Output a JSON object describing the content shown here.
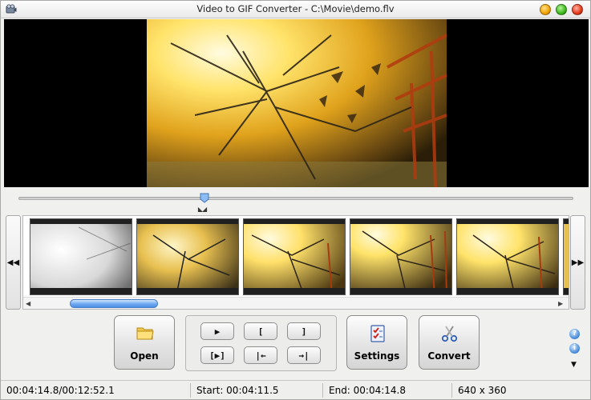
{
  "window": {
    "title": "Video to GIF Converter - C:\\Movie\\demo.flv"
  },
  "icons": {
    "app": "film-reel-icon",
    "open": "folder-icon",
    "settings": "checklist-icon",
    "convert": "scissors-icon",
    "help": "help-icon",
    "info": "info-icon"
  },
  "colors": {
    "accent_blue": "#4a8ee6",
    "minimize": "#f0a300",
    "maximize": "#3cb81c",
    "close": "#e33a1a"
  },
  "timeline": {
    "position_fraction": 0.335
  },
  "controls": {
    "open_label": "Open",
    "settings_label": "Settings",
    "convert_label": "Convert",
    "play_glyph": "▶",
    "mark_in_glyph": "[",
    "mark_out_glyph": "]",
    "play_selection_glyph": "[▶]",
    "go_start_glyph": "|←",
    "go_end_glyph": "→|"
  },
  "nav": {
    "prev_glyph": "◀◀",
    "next_glyph": "▶▶"
  },
  "status": {
    "position": "00:04:14.8/00:12:52.1",
    "start": "Start: 00:04:11.5",
    "end": "End: 00:04:14.8",
    "resolution": "640 x 360"
  }
}
